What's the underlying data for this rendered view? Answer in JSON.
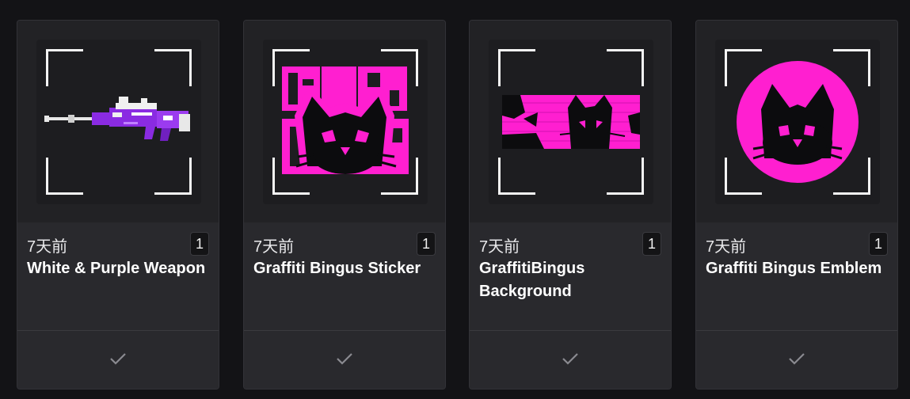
{
  "cards": [
    {
      "time": "7天前",
      "count": "1",
      "name": "White & Purple Weapon",
      "icon": "sniper-rifle-icon"
    },
    {
      "time": "7天前",
      "count": "1",
      "name": "Graffiti Bingus Sticker",
      "icon": "graffiti-cat-sticker-icon"
    },
    {
      "time": "7天前",
      "count": "1",
      "name": "GraffitiBingus Background",
      "icon": "graffiti-cat-banner-icon"
    },
    {
      "time": "7天前",
      "count": "1",
      "name": "Graffiti Bingus Emblem",
      "icon": "graffiti-cat-emblem-icon"
    }
  ],
  "colors": {
    "accent": "#ff1fd0",
    "purple": "#8a2be2",
    "background": "#131316",
    "card": "#262629"
  }
}
